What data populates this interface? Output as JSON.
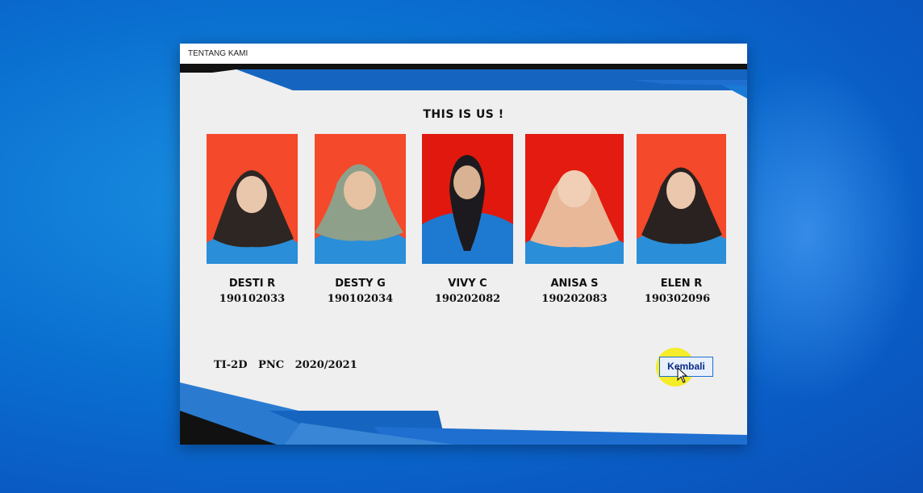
{
  "window": {
    "title": "TENTANG KAMI"
  },
  "heading": "THIS IS US !",
  "members": [
    {
      "name": "DESTI R",
      "nim": "190102033",
      "background": "#f4492a",
      "hijab": "#2e2622"
    },
    {
      "name": "DESTY G",
      "nim": "190102034",
      "background": "#f4492a",
      "hijab": "#8fa08a"
    },
    {
      "name": "VIVY C",
      "nim": "190202082",
      "background": "#e0180e",
      "hijab": "#1c1a1e"
    },
    {
      "name": "ANISA S",
      "nim": "190202083",
      "background": "#e41b10",
      "hijab": "#e8b898"
    },
    {
      "name": "ELEN R",
      "nim": "190302096",
      "background": "#f4492a",
      "hijab": "#2a2220"
    }
  ],
  "footer": "TI-2D   PNC   2020/2021",
  "back_button": {
    "label": "Kembali"
  },
  "colors": {
    "accent": "#1e6fd0",
    "desktop": "#0a6fd0"
  }
}
